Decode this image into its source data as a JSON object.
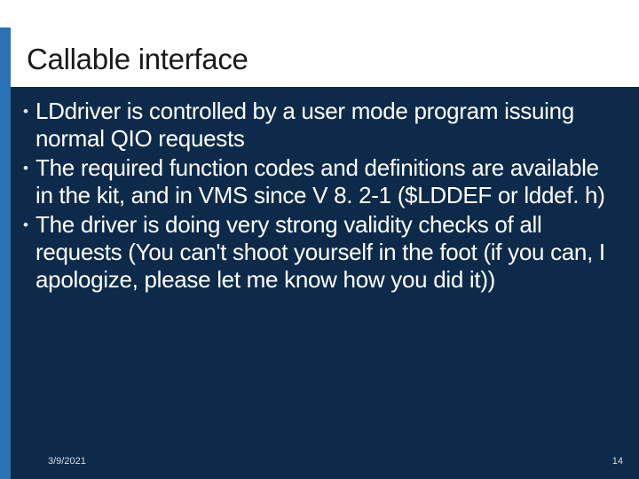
{
  "title": "Callable interface",
  "bullets": [
    "LDdriver is controlled by a user mode program issuing normal QIO requests",
    "The required function codes and definitions are available in the kit, and in VMS since V 8. 2-1 ($LDDEF or lddef. h)",
    "The driver is doing very strong validity checks of all requests (You can't shoot yourself in the foot (if you can, I apologize, please let me know how you did it))"
  ],
  "footer": {
    "date": "3/9/2021",
    "page": "14"
  },
  "bullet_glyph": "•"
}
